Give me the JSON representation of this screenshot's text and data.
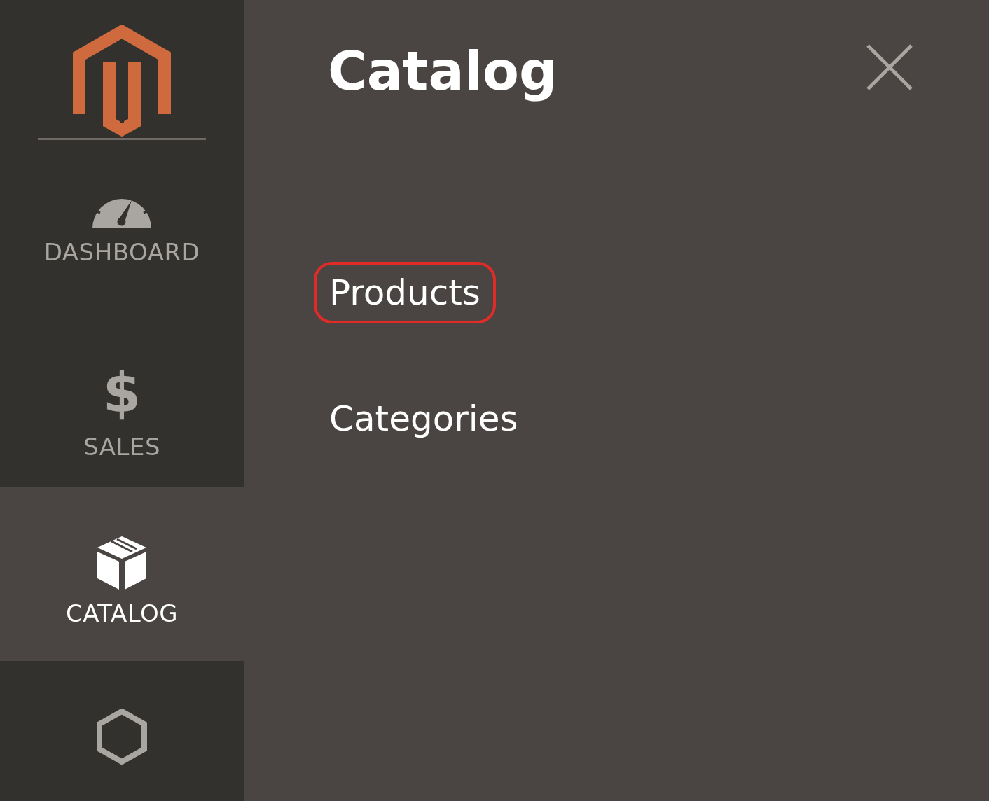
{
  "sidebar": {
    "items": [
      {
        "kind": "dashboard",
        "label": "DASHBOARD",
        "selected": false
      },
      {
        "kind": "sales",
        "glyph": "$",
        "label": "SALES",
        "selected": false
      },
      {
        "kind": "catalog",
        "label": "CATALOG",
        "selected": true
      },
      {
        "kind": "hexagon",
        "selected": false
      }
    ]
  },
  "panel": {
    "title": "Catalog",
    "links": [
      {
        "label": "Products",
        "highlighted": true
      },
      {
        "label": "Categories",
        "highlighted": false
      }
    ]
  }
}
